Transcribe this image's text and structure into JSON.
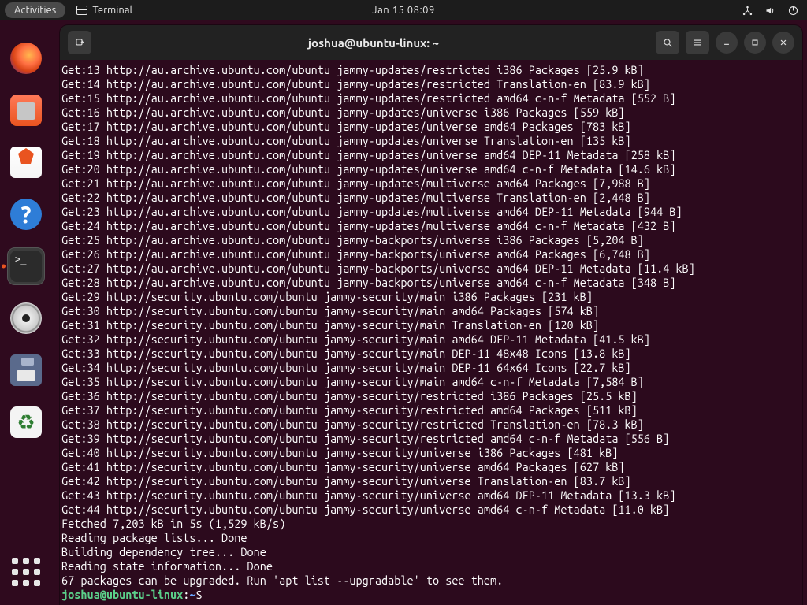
{
  "panel": {
    "activities": "Activities",
    "app_label": "Terminal",
    "clock": "Jan 15  08:09"
  },
  "dock": {
    "items": [
      {
        "name": "firefox",
        "label": "Firefox"
      },
      {
        "name": "files",
        "label": "Files"
      },
      {
        "name": "software",
        "label": "Ubuntu Software"
      },
      {
        "name": "help",
        "label": "Help"
      },
      {
        "name": "terminal",
        "label": "Terminal",
        "running": true,
        "active": true
      },
      {
        "name": "disc",
        "label": "Disc Mounted"
      },
      {
        "name": "floppy",
        "label": "Disk Mounted"
      },
      {
        "name": "trash",
        "label": "Trash"
      }
    ]
  },
  "window": {
    "title": "joshua@ubuntu-linux: ~"
  },
  "prompt": {
    "user": "joshua",
    "host": "ubuntu-linux",
    "path": "~",
    "symbol": "$"
  },
  "terminal": {
    "lines": [
      "Get:13 http://au.archive.ubuntu.com/ubuntu jammy-updates/restricted i386 Packages [25.9 kB]",
      "Get:14 http://au.archive.ubuntu.com/ubuntu jammy-updates/restricted Translation-en [83.9 kB]",
      "Get:15 http://au.archive.ubuntu.com/ubuntu jammy-updates/restricted amd64 c-n-f Metadata [552 B]",
      "Get:16 http://au.archive.ubuntu.com/ubuntu jammy-updates/universe i386 Packages [559 kB]",
      "Get:17 http://au.archive.ubuntu.com/ubuntu jammy-updates/universe amd64 Packages [783 kB]",
      "Get:18 http://au.archive.ubuntu.com/ubuntu jammy-updates/universe Translation-en [135 kB]",
      "Get:19 http://au.archive.ubuntu.com/ubuntu jammy-updates/universe amd64 DEP-11 Metadata [258 kB]",
      "Get:20 http://au.archive.ubuntu.com/ubuntu jammy-updates/universe amd64 c-n-f Metadata [14.6 kB]",
      "Get:21 http://au.archive.ubuntu.com/ubuntu jammy-updates/multiverse amd64 Packages [7,988 B]",
      "Get:22 http://au.archive.ubuntu.com/ubuntu jammy-updates/multiverse Translation-en [2,448 B]",
      "Get:23 http://au.archive.ubuntu.com/ubuntu jammy-updates/multiverse amd64 DEP-11 Metadata [944 B]",
      "Get:24 http://au.archive.ubuntu.com/ubuntu jammy-updates/multiverse amd64 c-n-f Metadata [432 B]",
      "Get:25 http://au.archive.ubuntu.com/ubuntu jammy-backports/universe i386 Packages [5,204 B]",
      "Get:26 http://au.archive.ubuntu.com/ubuntu jammy-backports/universe amd64 Packages [6,748 B]",
      "Get:27 http://au.archive.ubuntu.com/ubuntu jammy-backports/universe amd64 DEP-11 Metadata [11.4 kB]",
      "Get:28 http://au.archive.ubuntu.com/ubuntu jammy-backports/universe amd64 c-n-f Metadata [348 B]",
      "Get:29 http://security.ubuntu.com/ubuntu jammy-security/main i386 Packages [231 kB]",
      "Get:30 http://security.ubuntu.com/ubuntu jammy-security/main amd64 Packages [574 kB]",
      "Get:31 http://security.ubuntu.com/ubuntu jammy-security/main Translation-en [120 kB]",
      "Get:32 http://security.ubuntu.com/ubuntu jammy-security/main amd64 DEP-11 Metadata [41.5 kB]",
      "Get:33 http://security.ubuntu.com/ubuntu jammy-security/main DEP-11 48x48 Icons [13.8 kB]",
      "Get:34 http://security.ubuntu.com/ubuntu jammy-security/main DEP-11 64x64 Icons [22.7 kB]",
      "Get:35 http://security.ubuntu.com/ubuntu jammy-security/main amd64 c-n-f Metadata [7,584 B]",
      "Get:36 http://security.ubuntu.com/ubuntu jammy-security/restricted i386 Packages [25.5 kB]",
      "Get:37 http://security.ubuntu.com/ubuntu jammy-security/restricted amd64 Packages [511 kB]",
      "Get:38 http://security.ubuntu.com/ubuntu jammy-security/restricted Translation-en [78.3 kB]",
      "Get:39 http://security.ubuntu.com/ubuntu jammy-security/restricted amd64 c-n-f Metadata [556 B]",
      "Get:40 http://security.ubuntu.com/ubuntu jammy-security/universe i386 Packages [481 kB]",
      "Get:41 http://security.ubuntu.com/ubuntu jammy-security/universe amd64 Packages [627 kB]",
      "Get:42 http://security.ubuntu.com/ubuntu jammy-security/universe Translation-en [83.7 kB]",
      "Get:43 http://security.ubuntu.com/ubuntu jammy-security/universe amd64 DEP-11 Metadata [13.3 kB]",
      "Get:44 http://security.ubuntu.com/ubuntu jammy-security/universe amd64 c-n-f Metadata [11.0 kB]",
      "Fetched 7,203 kB in 5s (1,529 kB/s)",
      "Reading package lists... Done",
      "Building dependency tree... Done",
      "Reading state information... Done",
      "67 packages can be upgraded. Run 'apt list --upgradable' to see them."
    ]
  }
}
